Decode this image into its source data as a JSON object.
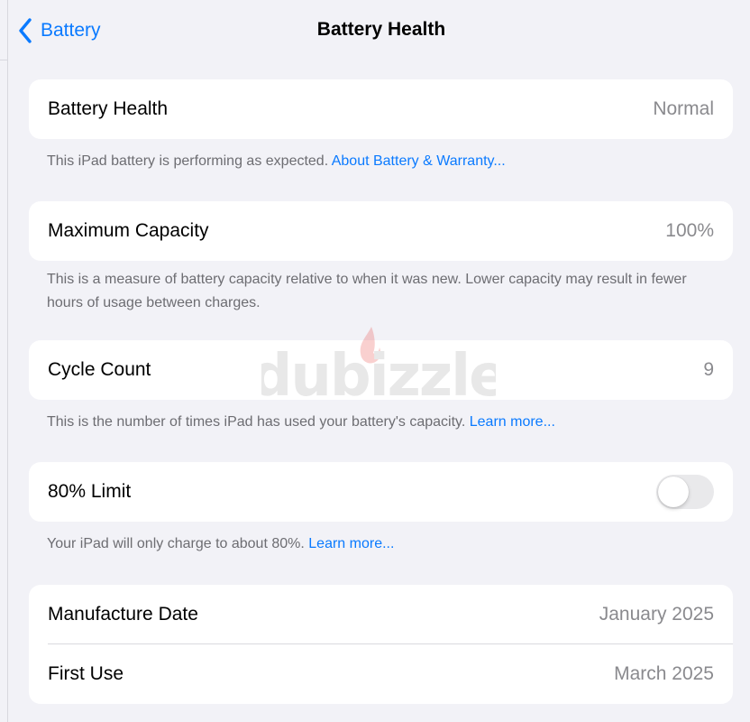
{
  "navbar": {
    "back_label": "Battery",
    "title": "Battery Health"
  },
  "sections": {
    "health": {
      "label": "Battery Health",
      "value": "Normal",
      "footnote_text": "This iPad battery is performing as expected. ",
      "footnote_link": "About Battery & Warranty..."
    },
    "capacity": {
      "label": "Maximum Capacity",
      "value": "100%",
      "footnote_text": "This is a measure of battery capacity relative to when it was new. Lower capacity may result in fewer hours of usage between charges."
    },
    "cycles": {
      "label": "Cycle Count",
      "value": "9",
      "footnote_text": "This is the number of times iPad has used your battery's capacity. ",
      "footnote_link": "Learn more..."
    },
    "limit": {
      "label": "80% Limit",
      "toggle_on": false,
      "footnote_text": "Your iPad will only charge to about 80%. ",
      "footnote_link": "Learn more..."
    },
    "dates": {
      "manufacture_label": "Manufacture Date",
      "manufacture_value": "January 2025",
      "first_use_label": "First Use",
      "first_use_value": "March 2025"
    }
  },
  "watermark": {
    "text": "dubizzle"
  },
  "colors": {
    "accent": "#0a7aff",
    "background": "#f2f2f7",
    "card": "#ffffff",
    "secondary_text": "#8a8a8e",
    "footnote_text": "#6d6d72",
    "toggle_off": "#e9e9eb",
    "watermark_flame": "#e8302b"
  },
  "icons": {
    "back": "chevron-left-icon",
    "watermark_flame": "flame-icon"
  }
}
